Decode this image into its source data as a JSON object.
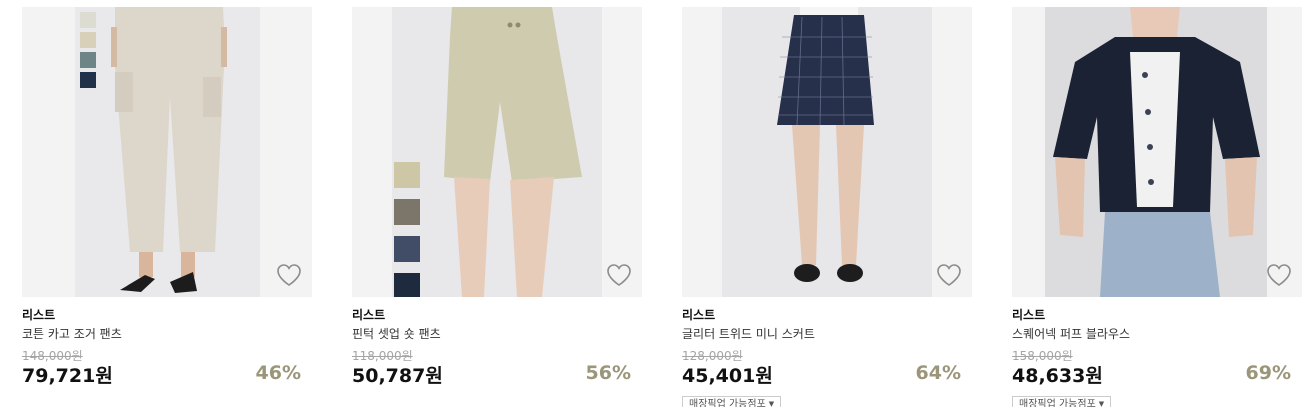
{
  "wishlist_icon": "heart-outline-icon",
  "products": [
    {
      "brand": "리스트",
      "name": "코튼 카고 조거 팬츠",
      "original_price": "148,000원",
      "sale_price": "79,721원",
      "discount": "46%",
      "swatch_colors": [
        "#dcdcd3",
        "#d8d0b8",
        "#6e8587",
        "#22314a"
      ]
    },
    {
      "brand": "리스트",
      "name": "핀턱 셋업 숏 팬츠",
      "original_price": "118,000원",
      "sale_price": "50,787원",
      "discount": "56%",
      "swatch_colors": [
        "#cdc7a6",
        "#7c766a",
        "#414c67",
        "#1e2a3d"
      ]
    },
    {
      "brand": "리스트",
      "name": "글리터 트위드 미니 스커트",
      "original_price": "128,000원",
      "sale_price": "45,401원",
      "discount": "64%",
      "store_pickup_label": "매장픽업 가능점포"
    },
    {
      "brand": "리스트",
      "name": "스퀘어넥 퍼프 블라우스",
      "original_price": "158,000원",
      "sale_price": "48,633원",
      "discount": "69%",
      "store_pickup_label": "매장픽업 가능점포"
    }
  ],
  "colors": {
    "discount": "#9b9579",
    "strike_price": "#a5a5a5"
  }
}
